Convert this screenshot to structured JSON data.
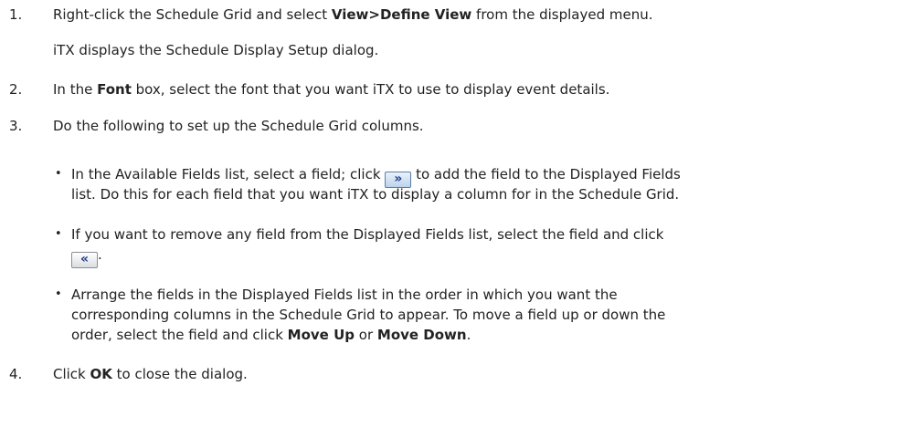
{
  "steps": [
    {
      "number": "1.",
      "line1": {
        "pre": "Right-click the Schedule Grid and select ",
        "bold": "View>Define View",
        "post": " from the displayed menu."
      },
      "line2": "iTX displays the Schedule Display Setup dialog."
    },
    {
      "number": "2.",
      "line1": {
        "pre": "In the ",
        "bold": "Font",
        "post": " box, select the font that you want iTX to use to display event details."
      }
    },
    {
      "number": "3.",
      "line1": "Do the following to set up the Schedule Grid columns.",
      "bullets": [
        {
          "l1_pre": "In the Available Fields list, select a field; click ",
          "button": "»",
          "l1_post": " to add the field to the Displayed Fields",
          "l2": "list. Do this for each field that you want iTX to display a column for in the Schedule Grid."
        },
        {
          "l1": "If you want to remove any field from the Displayed Fields list, select the field and click",
          "button": "«",
          "tail": "."
        },
        {
          "l1": "Arrange the fields in the Displayed Fields list in the order in which you want the",
          "l2": "corresponding columns in the Schedule Grid to appear. To move a field up or down the",
          "l3_pre": "order, select the field and click ",
          "l3_bold1": "Move Up",
          "l3_mid": " or ",
          "l3_bold2": "Move Down",
          "l3_post": "."
        }
      ]
    },
    {
      "number": "4.",
      "line1": {
        "pre": "Click ",
        "bold": "OK",
        "post": " to close the dialog."
      }
    }
  ],
  "bullet_glyph": "•"
}
